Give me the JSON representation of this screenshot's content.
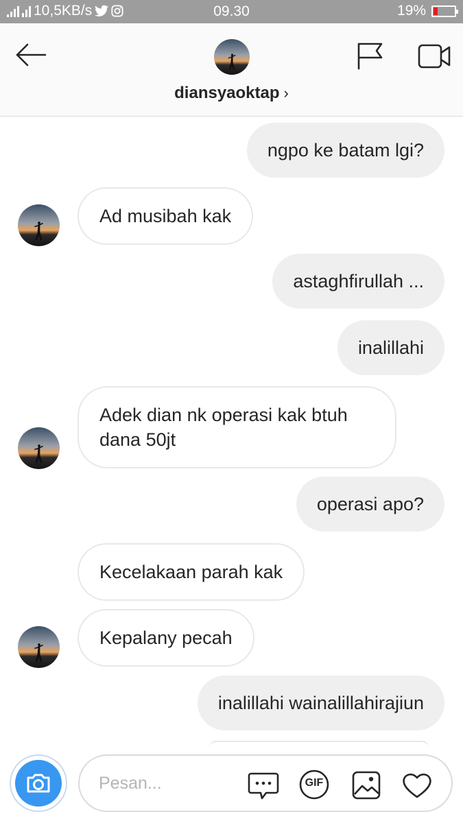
{
  "status_bar": {
    "network_speed": "10,5KB/s",
    "time": "09.30",
    "battery": "19%",
    "battery_level": 0.19
  },
  "header": {
    "username": "diansyaoktap",
    "chevron": "›",
    "icons": [
      "back-arrow-icon",
      "flag-icon",
      "video-call-icon"
    ]
  },
  "messages": [
    {
      "dir": "out",
      "text": "ngpo ke batam lgi?"
    },
    {
      "dir": "in",
      "text": "Ad musibah kak",
      "avatar": true
    },
    {
      "dir": "out",
      "text": "astaghfirullah ..."
    },
    {
      "dir": "out",
      "text": "inalillahi"
    },
    {
      "dir": "in",
      "text": "Adek dian nk operasi kak btuh dana 50jt",
      "avatar": true
    },
    {
      "dir": "out",
      "text": "operasi apo?"
    },
    {
      "dir": "in",
      "text": "Kecelakaan parah kak"
    },
    {
      "dir": "in",
      "text": "Kepalany pecah",
      "avatar": true
    },
    {
      "dir": "out",
      "text": "inalillahi wainalillahirajiun"
    }
  ],
  "composer": {
    "placeholder": "Pesan...",
    "gif_label": "GIF",
    "icons": [
      "camera-icon",
      "sticker-icon",
      "gif-icon",
      "gallery-icon",
      "heart-icon"
    ]
  },
  "colors": {
    "accent": "#3897f0",
    "status_bar": "#9d9d9d",
    "outgoing_bubble": "#efefef",
    "battery_low": "#e02020"
  }
}
